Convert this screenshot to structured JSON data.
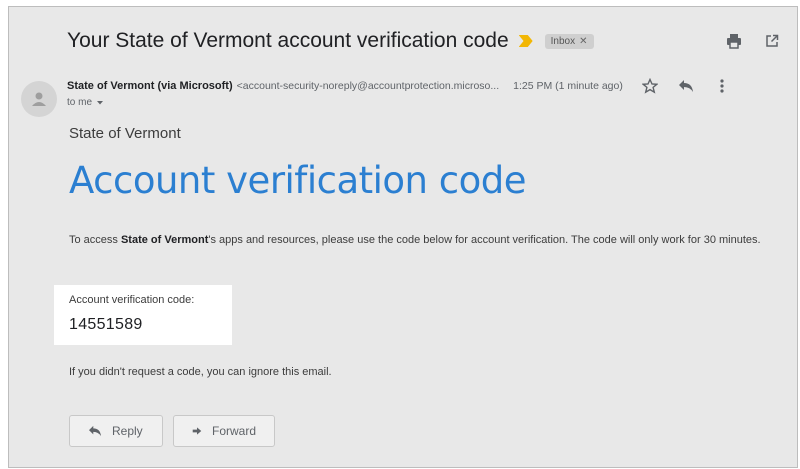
{
  "email": {
    "subject": "Your State of Vermont account verification code",
    "label": "Inbox",
    "sender_name": "State of Vermont (via Microsoft)",
    "sender_email": "<account-security-noreply@accountprotection.microso...",
    "time": "1:25 PM (1 minute ago)",
    "recipient": "to me"
  },
  "body": {
    "org_name": "State of Vermont",
    "headline": "Account verification code",
    "intro_prefix": "To access ",
    "intro_org": "State of Vermont",
    "intro_suffix": "'s apps and resources, please use the code below for account verification. The code will only work for 30 minutes.",
    "code_label": "Account verification code:",
    "code_value": "14551589",
    "ignore_text": "If you didn't request a code, you can ignore this email."
  },
  "actions": {
    "reply_label": "Reply",
    "forward_label": "Forward"
  },
  "icons": {
    "importance": "importance-marker-icon",
    "label_close": "close-icon",
    "print": "print-icon",
    "open_new_window": "open-in-new-icon",
    "avatar": "person-icon",
    "star": "star-icon",
    "reply": "reply-icon",
    "more": "more-vert-icon",
    "dropdown": "chevron-down-icon",
    "forward": "forward-icon"
  },
  "colors": {
    "headline": "#2b7fd1",
    "importance": "#f2b705",
    "background": "#e8e8e8"
  }
}
